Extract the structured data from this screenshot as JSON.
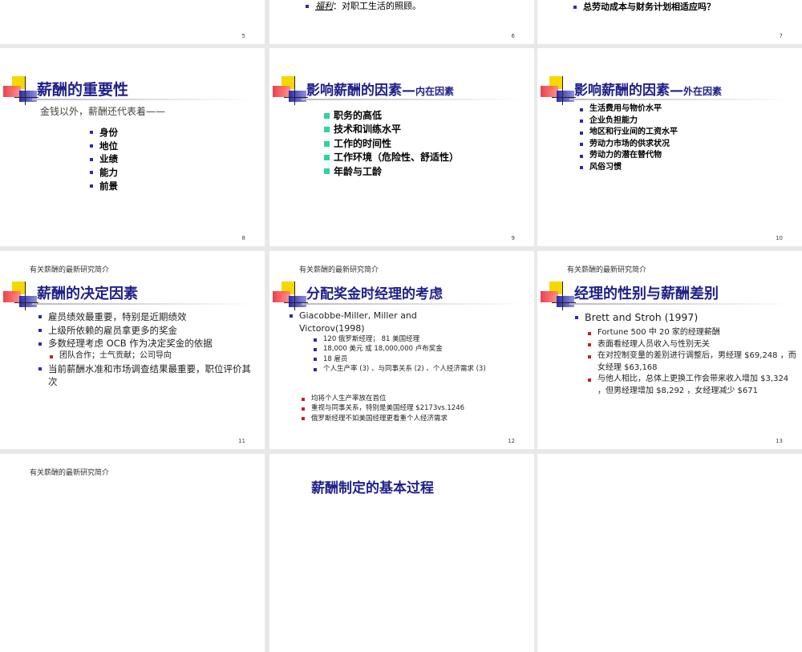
{
  "slides": [
    {
      "num": "5"
    },
    {
      "num": "6",
      "bullet_term": "福利",
      "bullet_text": "：对职工生活的照顾。"
    },
    {
      "num": "7",
      "bullet": "总劳动成本与财务计划相适应吗？"
    },
    {
      "num": "8",
      "title": "薪酬的重要性",
      "intro": "金钱以外，薪酬还代表着——",
      "items": [
        "身份",
        "地位",
        "业绩",
        "能力",
        "前景"
      ]
    },
    {
      "num": "9",
      "title": "影响薪酬的因素—",
      "title_suffix": "内在因素",
      "items": [
        "职务的高低",
        "技术和训练水平",
        "工作的时间性",
        "工作环境（危险性、舒适性）",
        "年龄与工龄"
      ]
    },
    {
      "num": "10",
      "title": "影响薪酬的因素—",
      "title_suffix": "外在因素",
      "items": [
        "生活费用与物价水平",
        "企业负担能力",
        "地区和行业间的工资水平",
        "劳动力市场的供求状况",
        "劳动力的潜在替代物",
        "风俗习惯"
      ]
    },
    {
      "num": "11",
      "header": "有关薪酬的最新研究简介",
      "title": "薪酬的决定因素",
      "items": [
        "雇员绩效最重要，特别是近期绩效",
        "上级所依赖的雇员拿更多的奖金",
        "多数经理考虑 OCB 作为决定奖金的依据",
        "当前薪酬水准和市场调查结果最重要，职位评价其次"
      ],
      "subitem": "团队合作；士气贡献；公司导向"
    },
    {
      "num": "12",
      "header": "有关薪酬的最新研究简介",
      "title": "分配奖金时经理的考虑",
      "lead": "Giacobbe-Miller, Miller and Victorov(1998)",
      "subitems": [
        "120 俄罗斯经理； 81 美国经理",
        "18,000 美元  或  18,000,000 卢布奖金",
        "18 雇员",
        "个人生产率 (3) 、与同事关系 (2) 、个人经济需求 (3)"
      ],
      "findings": [
        "均将个人生产率放在首位",
        "重视与同事关系，特别是美国经理 $2173vs.1246",
        "俄罗斯经理不如美国经理更看重个人经济需求"
      ]
    },
    {
      "num": "13",
      "header": "有关薪酬的最新研究简介",
      "title": "经理的性别与薪酬差别",
      "lead": "Brett and Stroh (1997)",
      "subitems": [
        "Fortune 500 中 20 家的经理薪酬",
        "表面看经理人员收入与性别无关",
        "在对控制变量的差别进行调整后，男经理 $69,248 ，而女经理 $63,168",
        "与他人相比，总体上更换工作会带来收入增加 $3,324 ，但男经理增加 $8,292 ，女经理减少 $671"
      ]
    },
    {
      "header": "有关薪酬的最新研究简介"
    },
    {
      "title": "薪酬制定的基本过程"
    },
    {}
  ]
}
